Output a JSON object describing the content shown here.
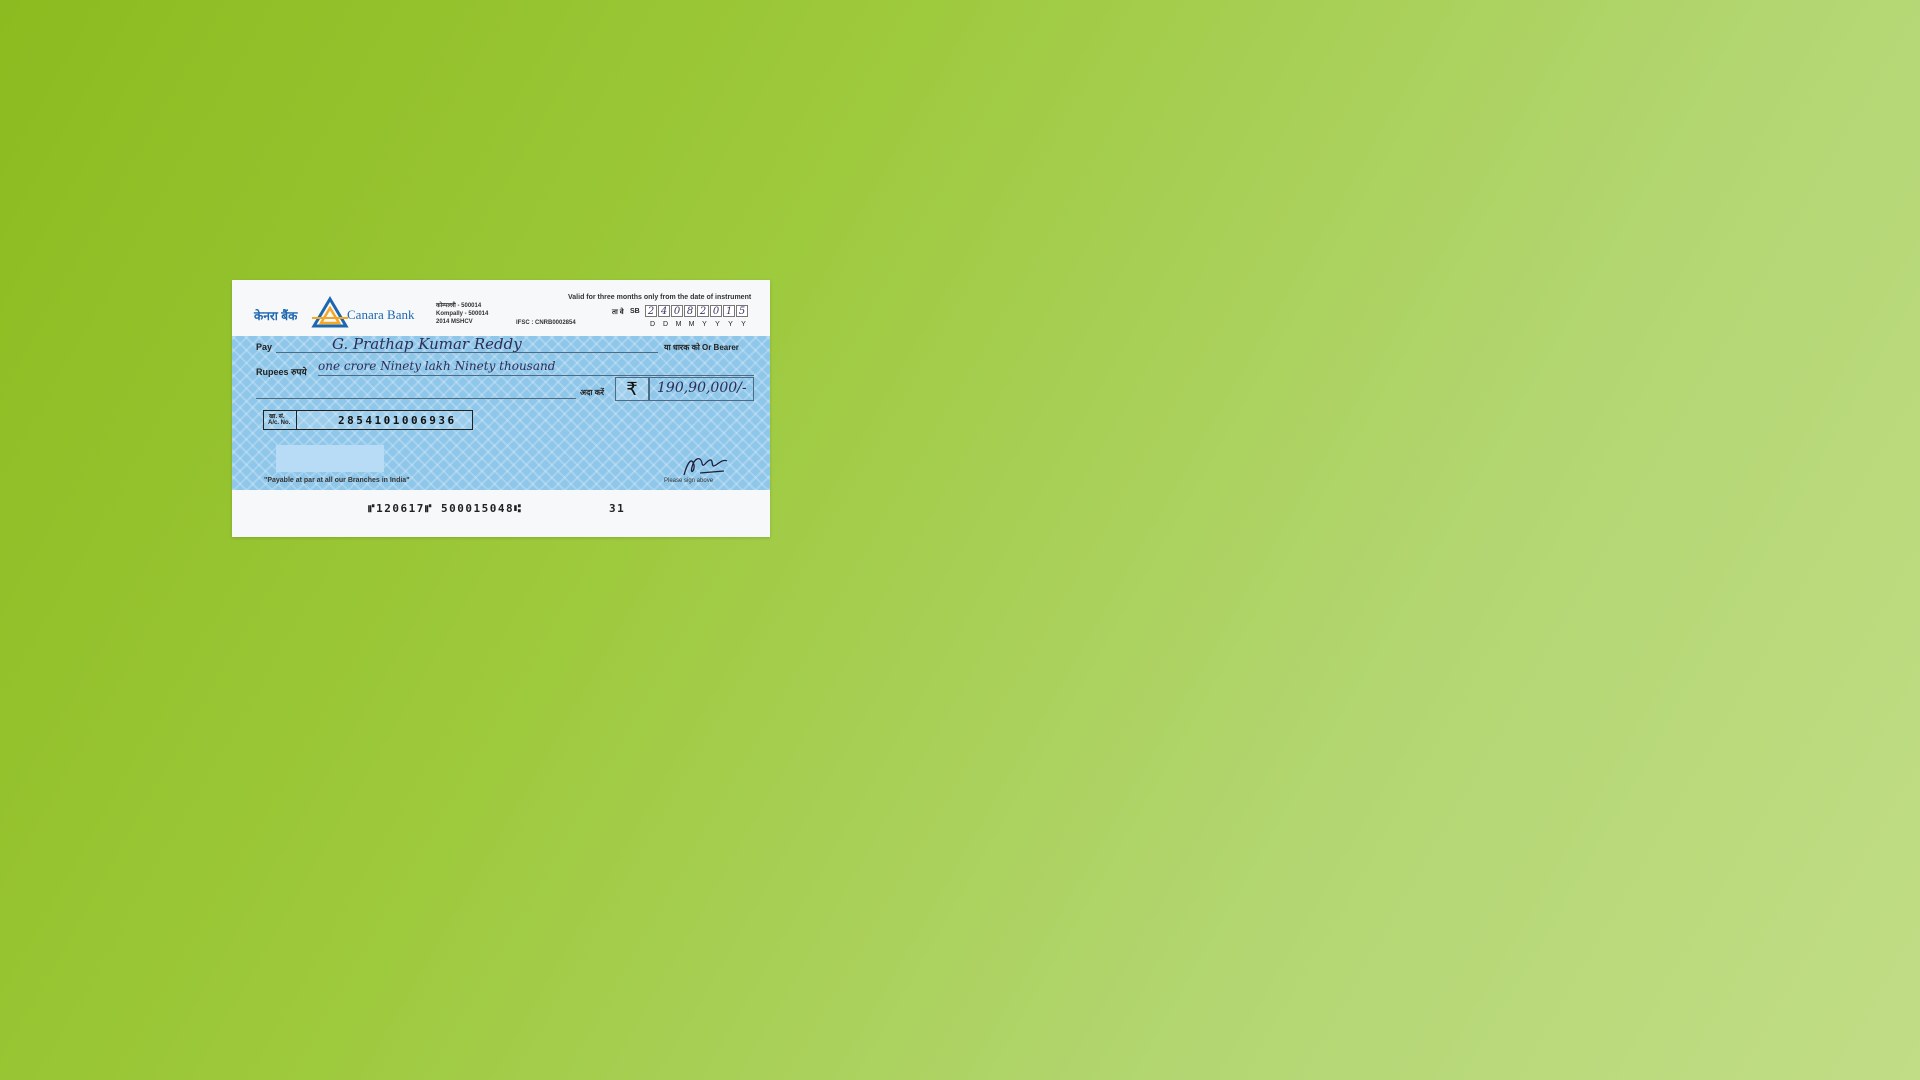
{
  "cheque": {
    "bank_name_hindi": "केनरा बैंक",
    "bank_name": "Canara Bank",
    "branch_lines": [
      "कोम्पल्ली - 500014",
      "Kompally - 500014",
      "2014 MSHCV"
    ],
    "ifsc": "IFSC : CNRB0002854",
    "validity_note": "Valid for three months only from the date of instrument",
    "date_label_hindi": "ता वे",
    "account_type": "SB",
    "date_digits": [
      "2",
      "4",
      "0",
      "8",
      "2",
      "0",
      "1",
      "5"
    ],
    "date_format": [
      "D",
      "D",
      "M",
      "M",
      "Y",
      "Y",
      "Y",
      "Y"
    ],
    "pay_label": "Pay",
    "payee": "G. Prathap Kumar Reddy",
    "bearer_label": "या धारक को Or Bearer",
    "rupees_label": "Rupees रुपये",
    "amount_words": "one crore Ninety lakh Ninety thousand",
    "ada_label": "अदा करें",
    "rupee_symbol": "₹",
    "amount_figures": "190,90,000/-",
    "acct_label_hindi": "खा. सं.",
    "acct_label": "A/c. No.",
    "account_number": "2854101006936",
    "payable_note": "\"Payable at par at all our Branches in India\"",
    "sign_label": "Please sign above",
    "micr_code": "⑈120617⑈ 500015048⑆",
    "micr_tail": "31",
    "colors": {
      "bank_blue": "#1d67b0",
      "cheque_body": "#8fc7ea",
      "background": "#9dc93b"
    }
  }
}
